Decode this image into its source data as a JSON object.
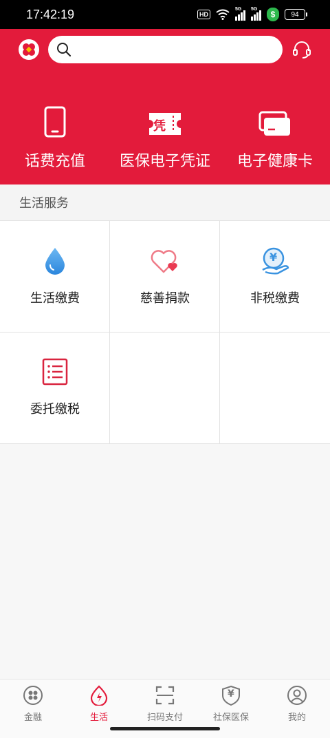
{
  "status_bar": {
    "time": "17:42:19",
    "hd_label": "HD",
    "network_1": "5G",
    "network_2": "5G",
    "shield_symbol": "$",
    "battery": "94"
  },
  "header": {
    "search": {
      "placeholder": "",
      "value": ""
    },
    "quick_actions": [
      {
        "label": "话费充值",
        "icon": "phone-icon"
      },
      {
        "label": "医保电子凭证",
        "icon": "voucher-icon",
        "icon_text": "凭"
      },
      {
        "label": "电子健康卡",
        "icon": "health-card-icon"
      }
    ],
    "brand_color": "#e31b3b"
  },
  "section": {
    "title": "生活服务",
    "items": [
      {
        "label": "生活缴费",
        "icon": "water-drop-icon"
      },
      {
        "label": "慈善捐款",
        "icon": "heart-icon"
      },
      {
        "label": "非税缴费",
        "icon": "yuan-coin-hand-icon",
        "icon_text": "¥"
      },
      {
        "label": "委托缴税",
        "icon": "list-document-icon"
      }
    ]
  },
  "bottom_nav": {
    "tabs": [
      {
        "label": "金融",
        "icon": "finance-icon"
      },
      {
        "label": "生活",
        "icon": "life-flame-icon",
        "active": true
      },
      {
        "label": "扫码支付",
        "icon": "scan-icon"
      },
      {
        "label": "社保医保",
        "icon": "shield-yuan-icon",
        "icon_text": "¥"
      },
      {
        "label": "我的",
        "icon": "profile-icon"
      }
    ]
  }
}
